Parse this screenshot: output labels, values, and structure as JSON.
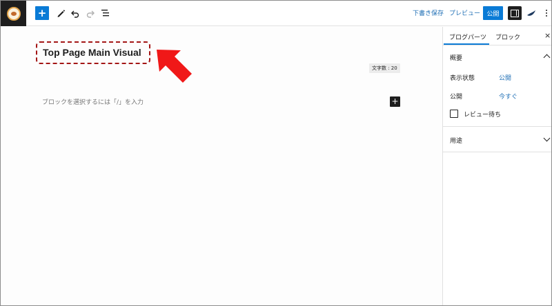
{
  "toolbar": {
    "inserter_symbol": "+",
    "save_draft_label": "下書き保存",
    "preview_label": "プレビュー",
    "publish_label": "公開"
  },
  "editor": {
    "post_title": "Top Page Main Visual",
    "char_count": "文字数 : 20",
    "block_placeholder": "ブロックを選択するには「/」を入力",
    "add_block_symbol": "+"
  },
  "sidebar": {
    "tabs": [
      {
        "label": "ブログパーツ",
        "active": true
      },
      {
        "label": "ブロック",
        "active": false
      }
    ],
    "close_symbol": "×",
    "summary": {
      "title": "概要",
      "visibility_label": "表示状態",
      "visibility_value": "公開",
      "publish_label": "公開",
      "publish_value": "今すぐ",
      "pending_review_label": "レビュー待ち",
      "pending_review_checked": false
    },
    "usage": {
      "title": "用途"
    }
  },
  "colors": {
    "accent": "#0a7bd6",
    "link": "#1f6fb5",
    "annotation": "#a31515",
    "arrow": "#f01818",
    "dark": "#1e1e1e"
  }
}
